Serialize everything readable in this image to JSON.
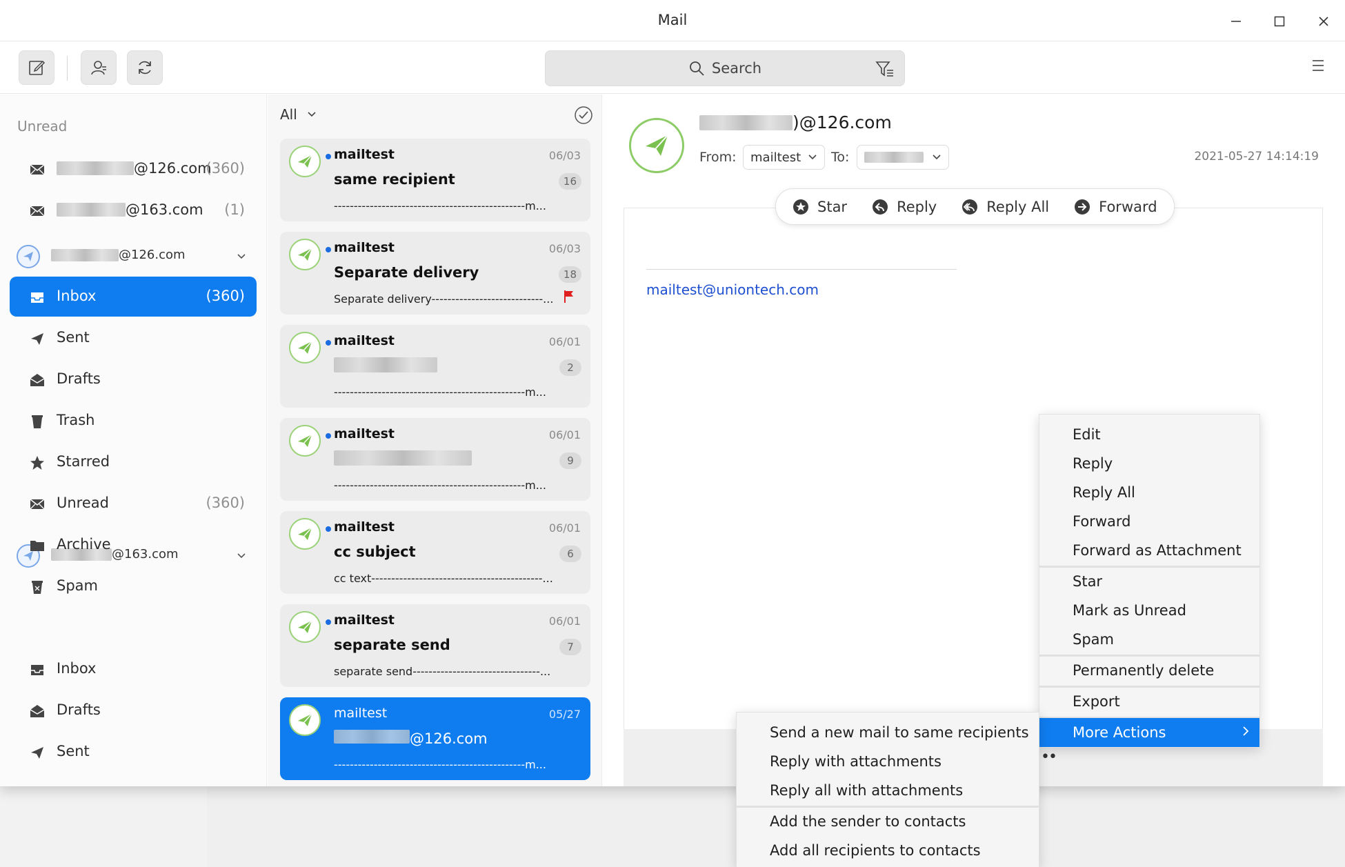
{
  "window": {
    "title": "Mail"
  },
  "toolbar": {
    "search_placeholder": "Search"
  },
  "sidebar": {
    "unread_header": "Unread",
    "unread_accounts": [
      {
        "domain": "@126.com",
        "count": "(360)"
      },
      {
        "domain": "@163.com",
        "count": "(1)"
      }
    ],
    "account1": {
      "domain": "@126.com"
    },
    "account1_folders": [
      {
        "label": "Inbox",
        "count": "(360)",
        "icon": "inbox-icon"
      },
      {
        "label": "Sent",
        "count": "",
        "icon": "paper-plane-icon"
      },
      {
        "label": "Drafts",
        "count": "",
        "icon": "drafts-icon"
      },
      {
        "label": "Trash",
        "count": "",
        "icon": "trash-icon"
      },
      {
        "label": "Starred",
        "count": "",
        "icon": "star-icon"
      },
      {
        "label": "Unread",
        "count": "(360)",
        "icon": "unread-icon"
      },
      {
        "label": "Archive",
        "count": "",
        "icon": "folder-icon"
      },
      {
        "label": "Spam",
        "count": "",
        "icon": "spam-icon"
      }
    ],
    "account2": {
      "domain": "@163.com"
    },
    "account2_folders": [
      {
        "label": "Inbox",
        "icon": "inbox-icon"
      },
      {
        "label": "Drafts",
        "icon": "drafts-icon"
      },
      {
        "label": "Sent",
        "icon": "paper-plane-icon"
      }
    ]
  },
  "list": {
    "filter": "All",
    "items": [
      {
        "from": "mailtest",
        "date": "06/03",
        "subject": "same recipient",
        "count": "16",
        "preview": "------------------------------------------------m..."
      },
      {
        "from": "mailtest",
        "date": "06/03",
        "subject": "Separate delivery",
        "count": "18",
        "preview": "Separate delivery----------------------------..."
      },
      {
        "from": "mailtest",
        "date": "06/01",
        "subject": "",
        "count": "2",
        "preview": "------------------------------------------------m..."
      },
      {
        "from": "mailtest",
        "date": "06/01",
        "subject": "",
        "count": "9",
        "preview": "------------------------------------------------m..."
      },
      {
        "from": "mailtest",
        "date": "06/01",
        "subject": "cc subject",
        "count": "6",
        "preview": "cc text-------------------------------------------..."
      },
      {
        "from": "mailtest",
        "date": "06/01",
        "subject": "separate send",
        "count": "7",
        "preview": "separate send--------------------------------..."
      },
      {
        "from": "mailtest",
        "date": "05/27",
        "subject": "@126.com",
        "count": "",
        "preview": "------------------------------------------------m..."
      }
    ]
  },
  "reader": {
    "sender_domain": ")@126.com",
    "from_label": "From:",
    "from_value": "mailtest",
    "to_label": "To:",
    "timestamp": "2021-05-27 14:14:19",
    "actions": {
      "star": "Star",
      "reply": "Reply",
      "reply_all": "Reply All",
      "forward": "Forward"
    },
    "body_link": "mailtest@uniontech.com"
  },
  "context_menu": {
    "edit": "Edit",
    "reply": "Reply",
    "reply_all": "Reply All",
    "forward": "Forward",
    "forward_attachment": "Forward as Attachment",
    "star": "Star",
    "mark_unread": "Mark as Unread",
    "spam": "Spam",
    "perm_delete": "Permanently delete",
    "export": "Export",
    "more_actions": "More Actions"
  },
  "submenu": {
    "send_new": "Send a new mail to same recipients",
    "reply_attach": "Reply with attachments",
    "reply_all_attach": "Reply all with attachments",
    "add_sender": "Add the sender to contacts",
    "add_all": "Add all recipients to contacts"
  },
  "colors": {
    "accent": "#0f7df0",
    "avatar_green": "#7ac14f",
    "flag_red": "#e02020"
  }
}
